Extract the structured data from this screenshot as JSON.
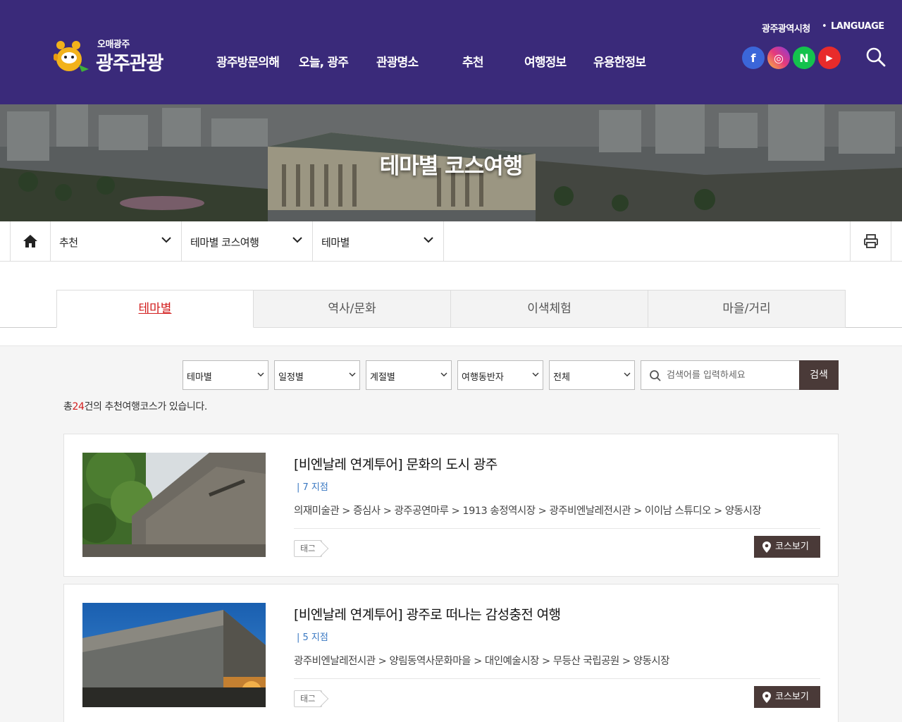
{
  "header": {
    "logo_small": "오매광주",
    "logo_big": "광주관광",
    "nav": [
      "광주방문의해",
      "오늘, 광주",
      "관광명소",
      "추천",
      "여행정보",
      "유용한정보"
    ],
    "util_links": [
      "광주광역시청",
      "LANGUAGE"
    ],
    "util_separator": "•",
    "sns": [
      {
        "name": "facebook-icon",
        "glyph": "f"
      },
      {
        "name": "instagram-icon",
        "glyph": "◎"
      },
      {
        "name": "naver-icon",
        "glyph": "N"
      },
      {
        "name": "youtube-icon",
        "glyph": "▶"
      }
    ]
  },
  "hero": {
    "title": "테마별 코스여행"
  },
  "location": {
    "level1": "추천",
    "level2": "테마별 코스여행",
    "level3": "테마별"
  },
  "tabs": [
    {
      "label": "테마별",
      "active": true
    },
    {
      "label": "역사/문화",
      "active": false
    },
    {
      "label": "이색체험",
      "active": false
    },
    {
      "label": "마을/거리",
      "active": false
    }
  ],
  "filters": {
    "selects": [
      "테마별",
      "일정별",
      "계절별",
      "여행동반자",
      "전체"
    ],
    "search_placeholder": "검색어를 입력하세요",
    "search_button": "검색"
  },
  "result": {
    "prefix": "총",
    "count": "24",
    "suffix": "건의 추천여행코스가 있습니다."
  },
  "courses": [
    {
      "title": "[비엔날레 연계투어] 문화의 도시 광주",
      "count": "| 7 지점",
      "route": "의재미술관 > 증심사 > 광주공연마루 > 1913 송정역시장 > 광주비엔날레전시관 > 이이남 스튜디오 > 양동시장",
      "tag": "태그",
      "button": "코스보기"
    },
    {
      "title": "[비엔날레 연계투어] 광주로 떠나는 감성충전 여행",
      "count": "| 5 지점",
      "route": "광주비엔날레전시관 > 양림동역사문화마을 > 대인예술시장 > 무등산 국립공원 > 양동시장",
      "tag": "태그",
      "button": "코스보기"
    }
  ],
  "colors": {
    "header_bg": "#3a2a7a",
    "accent_red": "#d21e1e",
    "button_dark": "#4a3a38",
    "link_blue": "#3a78c2"
  }
}
